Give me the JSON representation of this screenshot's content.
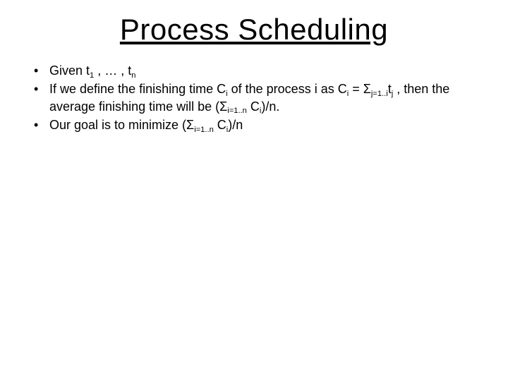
{
  "title": "Process Scheduling",
  "bullets": {
    "b1": {
      "p1": "Given t",
      "s1": "1",
      "p2": " , … , t",
      "s2": "n"
    },
    "b2": {
      "p1": "If we define the finishing time C",
      "s1": "i",
      "p2": " of the process i as C",
      "s2": "i",
      "p3": " = Σ",
      "s3": "j=1..i",
      "p4": "t",
      "s4": "j",
      "p5": " , then the average finishing time will be  (Σ",
      "s5": "i=1..n",
      "p6": " C",
      "s6": "i",
      "p7": ")/n."
    },
    "b3": {
      "p1": "Our goal is to minimize (Σ",
      "s1": "i=1..n",
      "p2": " C",
      "s2": "i",
      "p3": ")/n"
    }
  }
}
